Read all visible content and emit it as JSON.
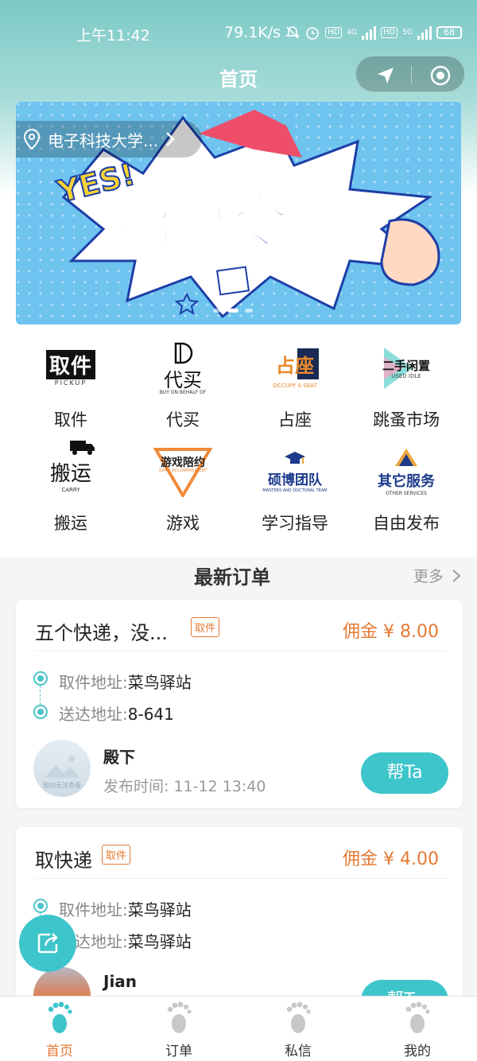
{
  "status": {
    "time": "上午11:42",
    "speed": "79.1K/s",
    "hd1": "HD",
    "net1": "4G",
    "hd2": "HD",
    "net2": "5G",
    "battery": "68"
  },
  "nav": {
    "title": "首页"
  },
  "banner": {
    "location": "电子科技大学...",
    "headline": "招募令",
    "yes": "YES!",
    "slides": 3,
    "active_slide": 1
  },
  "services": [
    {
      "label": "取件",
      "logo_text": "取件",
      "logo_sub": "PICKUP"
    },
    {
      "label": "代买",
      "logo_text": "代买",
      "logo_sub": "BUY ON BEHALF OF"
    },
    {
      "label": "占座",
      "logo_text": "占座",
      "logo_sub": "OCCUPY A SEAT"
    },
    {
      "label": "跳蚤市场",
      "logo_text": "二手闲置",
      "logo_sub": "USED IDLE"
    },
    {
      "label": "搬运",
      "logo_text": "搬运",
      "logo_sub": "CARRY"
    },
    {
      "label": "游戏",
      "logo_text": "游戏陪约",
      "logo_sub": "GAME ACCOMPANIMENT"
    },
    {
      "label": "学习指导",
      "logo_text": "硕博团队",
      "logo_sub": "MASTERS AND DOCTORAL TEAM"
    },
    {
      "label": "自由发布",
      "logo_text": "其它服务",
      "logo_sub": "OTHER SERVICES"
    }
  ],
  "orders_section": {
    "title": "最新订单",
    "more": "更多"
  },
  "orders": [
    {
      "title": "五个快递，没...",
      "tag": "取件",
      "commission": "佣金 ¥ 8.00",
      "pickup_label": "取件地址:",
      "pickup": "菜鸟驿站",
      "deliver_label": "送达地址:",
      "deliver": "8-641",
      "user": "殿下",
      "time": "发布时间: 11-12 13:40",
      "avatar_text": "暂时无法查看",
      "action": "帮Ta"
    },
    {
      "title": "取快递",
      "tag": "取件",
      "commission": "佣金 ¥ 4.00",
      "pickup_label": "取件地址:",
      "pickup": "菜鸟驿站",
      "deliver_label": "送达地址:",
      "deliver": "菜鸟驿站",
      "user": "Jian",
      "action": "帮Ta"
    }
  ],
  "tabs": [
    {
      "label": "首页",
      "active": true
    },
    {
      "label": "订单",
      "active": false
    },
    {
      "label": "私信",
      "active": false
    },
    {
      "label": "我的",
      "active": false
    }
  ],
  "colors": {
    "accent": "#3dc5cb",
    "orange": "#e57a35",
    "header": "#7cc9c6"
  }
}
